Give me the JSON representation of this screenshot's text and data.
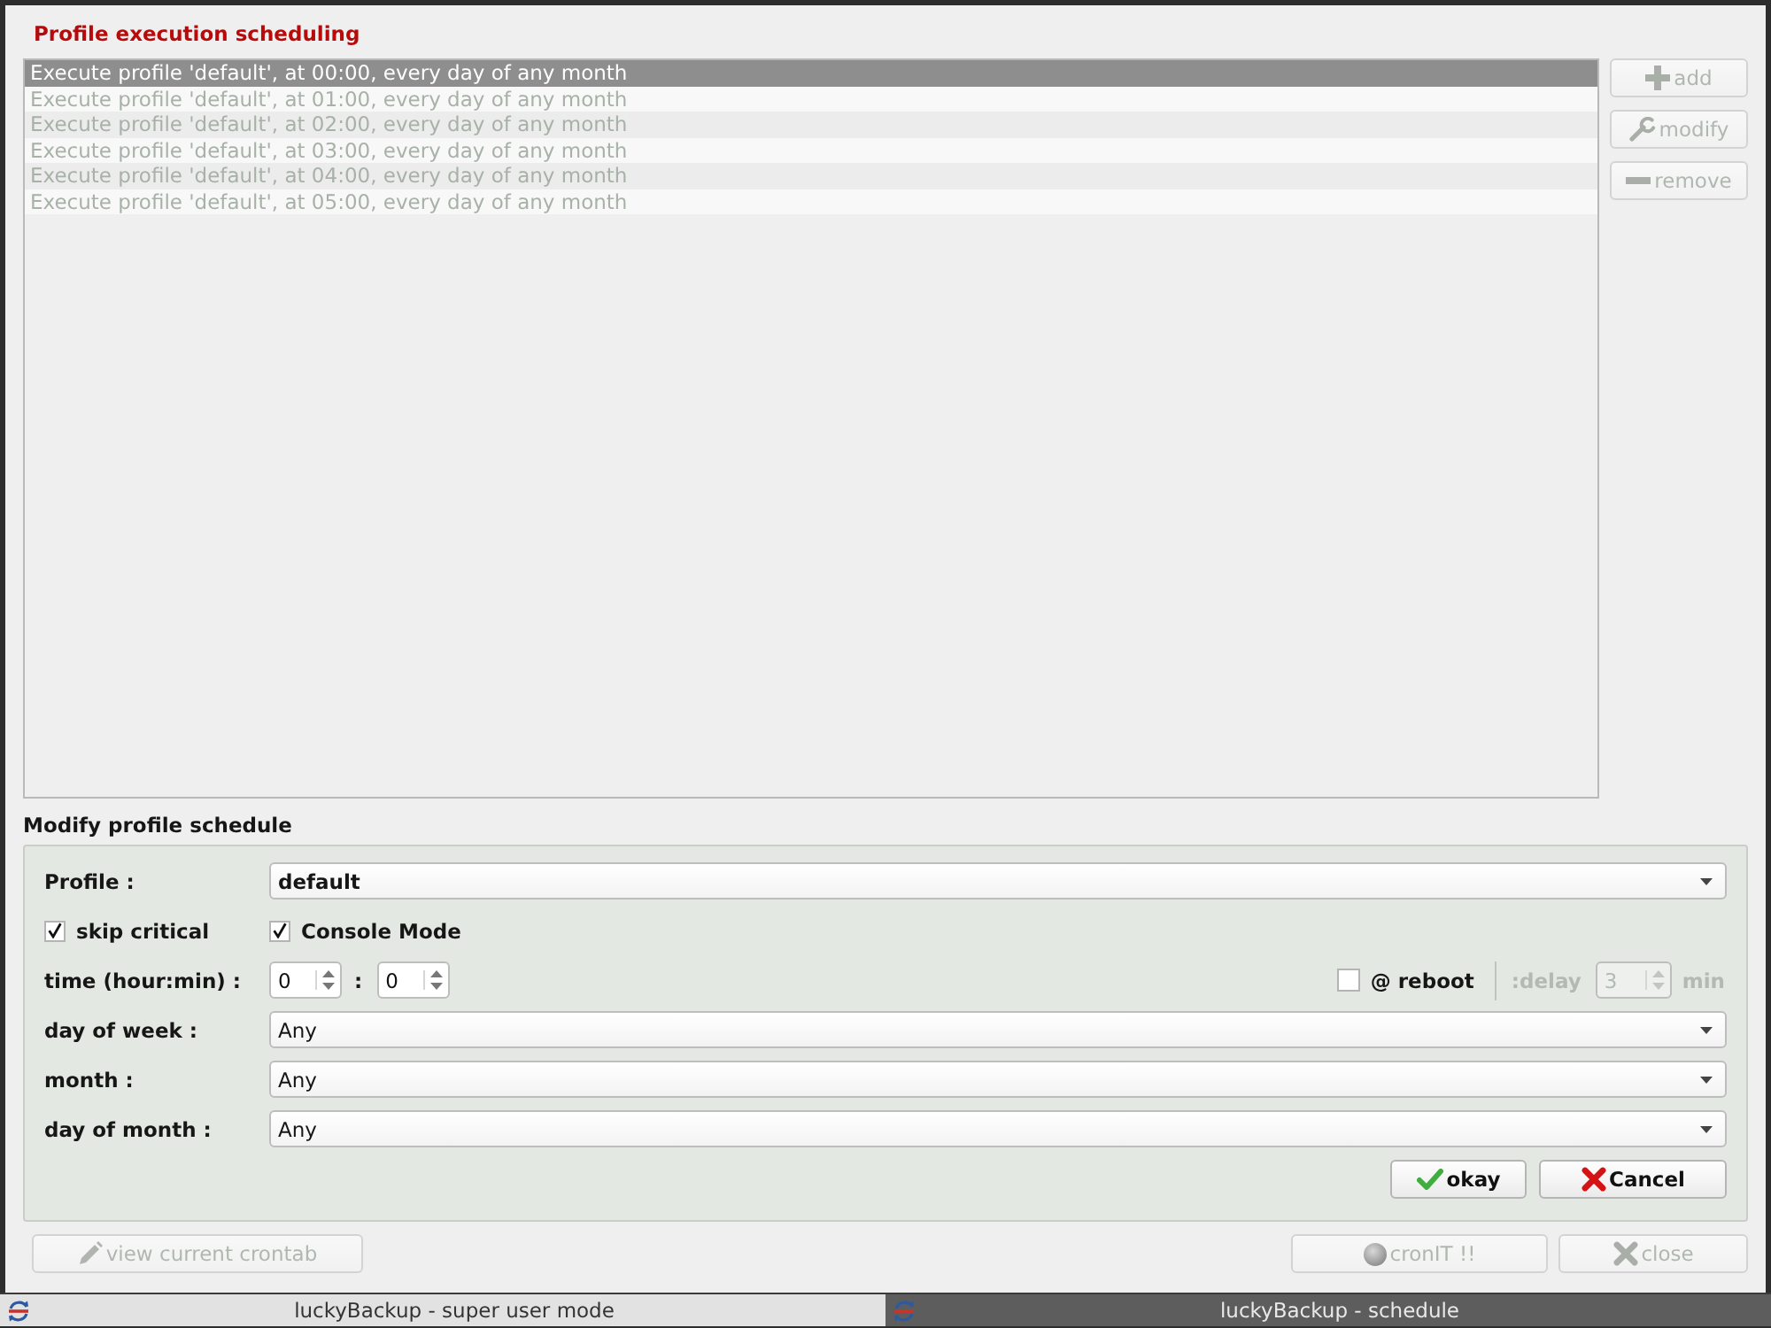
{
  "window": {
    "title": "Profile execution scheduling"
  },
  "schedule_list": {
    "disabled": true,
    "rows": [
      {
        "text": "Execute profile 'default', at 00:00, every day of any month",
        "selected": true
      },
      {
        "text": "Execute profile 'default', at 01:00, every day of any month",
        "selected": false
      },
      {
        "text": "Execute profile 'default', at 02:00, every day of any month",
        "selected": false
      },
      {
        "text": "Execute profile 'default', at 03:00, every day of any month",
        "selected": false
      },
      {
        "text": "Execute profile 'default', at 04:00, every day of any month",
        "selected": false
      },
      {
        "text": "Execute profile 'default', at 05:00, every day of any month",
        "selected": false
      }
    ]
  },
  "list_buttons": [
    {
      "label": "add",
      "kind": "add",
      "disabled": true
    },
    {
      "label": "modify",
      "kind": "modify",
      "disabled": true
    },
    {
      "label": "remove",
      "kind": "remove",
      "disabled": true
    }
  ],
  "editor": {
    "title": "Modify profile schedule",
    "profile": {
      "label": "Profile :",
      "value": "default"
    },
    "options": [
      {
        "label": "skip critical",
        "checked": true
      },
      {
        "label": "Console Mode",
        "checked": true
      }
    ],
    "time": {
      "label": "time (hour:min) :",
      "hour": "0",
      "separator": ":",
      "minute": "0"
    },
    "reboot": {
      "label": "@ reboot",
      "checked": false
    },
    "delay": {
      "label": ":delay",
      "value": "3",
      "unit": "min",
      "disabled": true
    },
    "selectors": [
      {
        "label": "day of week :",
        "value": "Any"
      },
      {
        "label": "month :",
        "value": "Any"
      },
      {
        "label": "day of month :",
        "value": "Any"
      }
    ],
    "buttons": [
      {
        "label": "okay",
        "kind": "ok"
      },
      {
        "label": "Cancel",
        "kind": "cancel"
      }
    ]
  },
  "footer_buttons": [
    {
      "label": "view current crontab",
      "kind": "crontab",
      "disabled": true
    },
    {
      "label": "cronIT !!",
      "kind": "cron",
      "disabled": true
    },
    {
      "label": "close",
      "kind": "close",
      "disabled": true
    }
  ],
  "taskbar": [
    {
      "title": "luckyBackup - super user mode",
      "selected": false
    },
    {
      "title": "luckyBackup - schedule",
      "selected": true
    }
  ]
}
